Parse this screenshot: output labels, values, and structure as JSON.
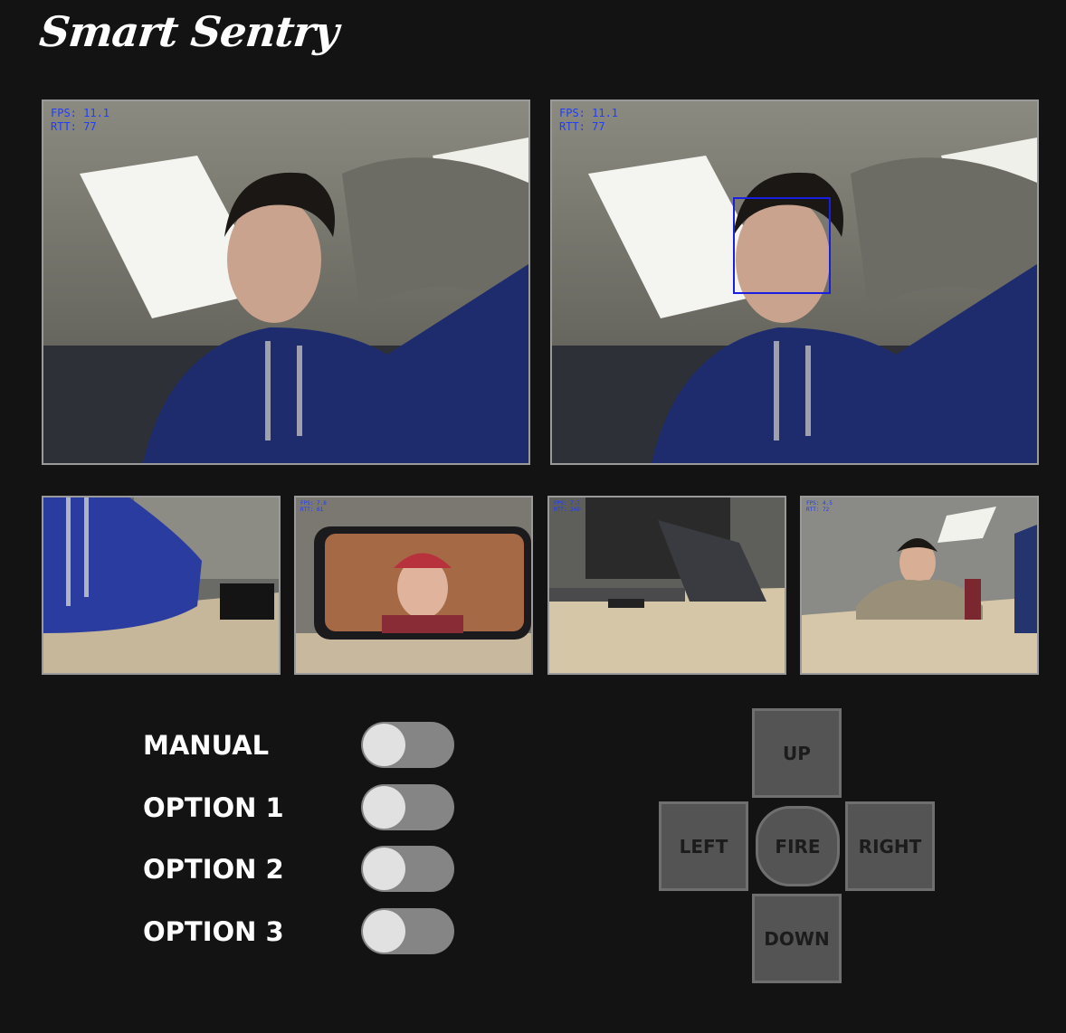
{
  "app": {
    "title": "Smart Sentry"
  },
  "feeds": {
    "main_left": {
      "fps": "FPS: 11.1",
      "rtt": "RTT: 77"
    },
    "main_right": {
      "fps": "FPS: 11.1",
      "rtt": "RTT: 77"
    },
    "thumbs": [
      {
        "fps": "",
        "rtt": ""
      },
      {
        "fps": "FPS: 7.8",
        "rtt": "RTT: 61"
      },
      {
        "fps": "FPS: 7.7",
        "rtt": "RTT: 249"
      },
      {
        "fps": "FPS: 4.5",
        "rtt": "RTT: 72"
      }
    ]
  },
  "options": [
    {
      "label": "MANUAL",
      "on": false
    },
    {
      "label": "OPTION 1",
      "on": false
    },
    {
      "label": "OPTION 2",
      "on": false
    },
    {
      "label": "OPTION 3",
      "on": false
    }
  ],
  "dpad": {
    "up": "UP",
    "left": "LEFT",
    "fire": "FIRE",
    "right": "RIGHT",
    "down": "DOWN"
  },
  "colors": {
    "background": "#131313",
    "overlay_text": "#1f3cff",
    "detection_box": "#1a1ee0",
    "toggle_track": "#858585",
    "toggle_knob": "#e1e1e1",
    "button_fill": "#545454"
  }
}
